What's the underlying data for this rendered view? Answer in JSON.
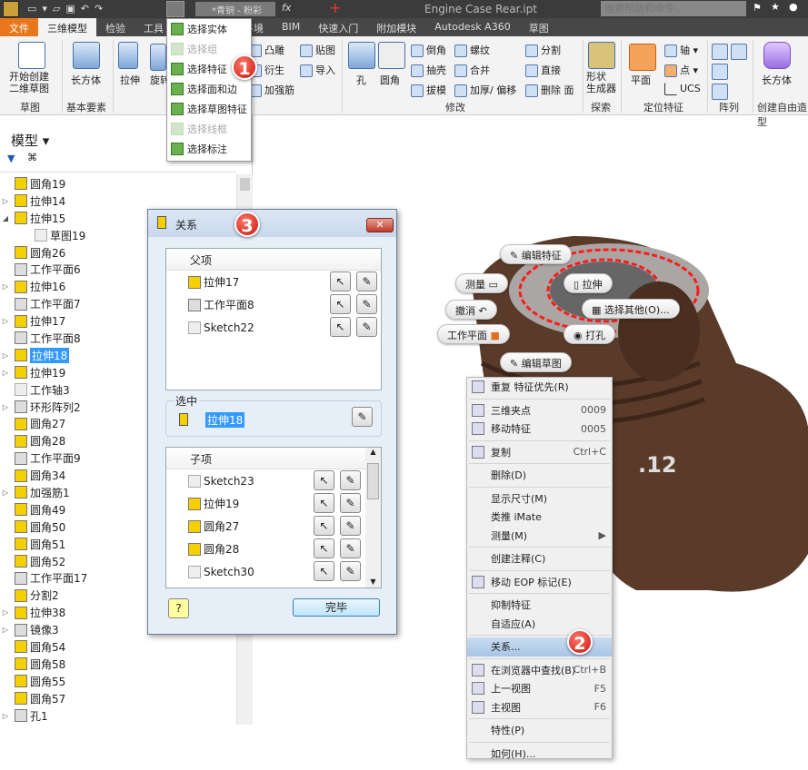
{
  "titlebar": {
    "title": "Engine Case Rear.ipt",
    "material": "*青铜 - 粉彩",
    "search_placeholder": "搜索帮助和命令..."
  },
  "tabs": [
    "文件",
    "三维模型",
    "检验",
    "工具",
    "环境",
    "BIM",
    "快速入门",
    "附加模块",
    "Autodesk A360",
    "草图"
  ],
  "ribbon": {
    "start_sketch": "开始创建\n二维草图",
    "box": "长方体",
    "extrude": "拉伸",
    "revolve": "旋转",
    "emboss": "凸雕",
    "derive": "衍生",
    "rib": "加强筋",
    "decal": "贴图",
    "import": "导入",
    "hole": "孔",
    "fillet": "圆角",
    "chamfer": "倒角",
    "thread": "螺纹",
    "split": "分割",
    "shell": "抽壳",
    "combine": "合并",
    "direct": "直接",
    "draft": "拔模",
    "thicken": "加厚/ 偏移",
    "delete_face": "删除 面",
    "shape_gen": "形状\n生成器",
    "plane": "平面",
    "axis": "轴",
    "point": "点",
    "ucs": "UCS",
    "freeform_box": "长方体",
    "groups": {
      "sketch": "草图",
      "primitives": "基本要素",
      "modify": "修改",
      "explore": "探索",
      "work_features": "定位特征",
      "pattern": "阵列",
      "freeform": "创建自由造型"
    }
  },
  "select_menu": [
    {
      "label": "选择实体",
      "enabled": true
    },
    {
      "label": "选择组",
      "enabled": false
    },
    {
      "label": "选择特征",
      "enabled": true
    },
    {
      "label": "选择面和边",
      "enabled": true
    },
    {
      "label": "选择草图特征",
      "enabled": true
    },
    {
      "label": "选择线框",
      "enabled": false
    },
    {
      "label": "选择标注",
      "enabled": true
    }
  ],
  "badges": [
    "1",
    "2",
    "3"
  ],
  "browser": {
    "title": "模型",
    "items": [
      {
        "label": "圆角19",
        "type": "fillet",
        "exp": ""
      },
      {
        "label": "拉伸14",
        "type": "extrude",
        "exp": "▷"
      },
      {
        "label": "拉伸15",
        "type": "extrude",
        "exp": "◢"
      },
      {
        "label": "草图19",
        "type": "sketch",
        "exp": "",
        "child": true
      },
      {
        "label": "圆角26",
        "type": "fillet",
        "exp": ""
      },
      {
        "label": "工作平面6",
        "type": "plane",
        "exp": ""
      },
      {
        "label": "拉伸16",
        "type": "extrude",
        "exp": "▷"
      },
      {
        "label": "工作平面7",
        "type": "plane",
        "exp": ""
      },
      {
        "label": "拉伸17",
        "type": "extrude",
        "exp": "▷"
      },
      {
        "label": "工作平面8",
        "type": "plane",
        "exp": ""
      },
      {
        "label": "拉伸18",
        "type": "extrude",
        "exp": "▷",
        "selected": true
      },
      {
        "label": "拉伸19",
        "type": "extrude",
        "exp": "▷"
      },
      {
        "label": "工作轴3",
        "type": "sketch",
        "exp": ""
      },
      {
        "label": "环形阵列2",
        "type": "plane",
        "exp": "▷"
      },
      {
        "label": "圆角27",
        "type": "fillet",
        "exp": ""
      },
      {
        "label": "圆角28",
        "type": "fillet",
        "exp": ""
      },
      {
        "label": "工作平面9",
        "type": "plane",
        "exp": ""
      },
      {
        "label": "圆角34",
        "type": "fillet",
        "exp": ""
      },
      {
        "label": "加强筋1",
        "type": "fillet",
        "exp": "▷"
      },
      {
        "label": "圆角49",
        "type": "fillet",
        "exp": ""
      },
      {
        "label": "圆角50",
        "type": "fillet",
        "exp": ""
      },
      {
        "label": "圆角51",
        "type": "fillet",
        "exp": ""
      },
      {
        "label": "圆角52",
        "type": "fillet",
        "exp": ""
      },
      {
        "label": "工作平面17",
        "type": "plane",
        "exp": ""
      },
      {
        "label": "分割2",
        "type": "fillet",
        "exp": ""
      },
      {
        "label": "拉伸38",
        "type": "extrude",
        "exp": "▷"
      },
      {
        "label": "镜像3",
        "type": "plane",
        "exp": "▷"
      },
      {
        "label": "圆角54",
        "type": "fillet",
        "exp": ""
      },
      {
        "label": "圆角58",
        "type": "fillet",
        "exp": ""
      },
      {
        "label": "圆角55",
        "type": "fillet",
        "exp": ""
      },
      {
        "label": "圆角57",
        "type": "fillet",
        "exp": ""
      },
      {
        "label": "孔1",
        "type": "plane",
        "exp": "▷"
      }
    ]
  },
  "dialog": {
    "title": "关系",
    "parents_header": "父项",
    "parents": [
      "拉伸17",
      "工作平面8",
      "Sketch22"
    ],
    "selected_label": "选中",
    "selected": "拉伸18",
    "children_header": "子项",
    "children": [
      "Sketch23",
      "拉伸19",
      "圆角27",
      "圆角28",
      "Sketch30"
    ],
    "help": "?",
    "done": "完毕"
  },
  "marking_menu": {
    "edit_feature": "编辑特征",
    "measure": "测量",
    "undo": "撤消",
    "work_plane": "工作平面",
    "extrude": "拉伸",
    "select_other": "选择其他(O)...",
    "hole": "打孔",
    "edit_sketch": "编辑草图"
  },
  "model_text": ".12",
  "context_menu": [
    {
      "label": "重复 特征优先(R)",
      "icon": true
    },
    {
      "sep": true
    },
    {
      "label": "三维夹点",
      "shortcut": "0009",
      "icon": true
    },
    {
      "label": "移动特征",
      "shortcut": "0005",
      "icon": true
    },
    {
      "sep": true
    },
    {
      "label": "复制",
      "shortcut": "Ctrl+C",
      "icon": true
    },
    {
      "sep": true
    },
    {
      "label": "删除(D)"
    },
    {
      "sep": true
    },
    {
      "label": "显示尺寸(M)"
    },
    {
      "label": "类推 iMate"
    },
    {
      "label": "测量(M)",
      "shortcut": "▶"
    },
    {
      "sep": true
    },
    {
      "label": "创建注释(C)"
    },
    {
      "sep": true
    },
    {
      "label": "移动 EOP 标记(E)",
      "icon": true
    },
    {
      "sep": true
    },
    {
      "label": "抑制特征"
    },
    {
      "label": "自适应(A)"
    },
    {
      "sep": true
    },
    {
      "label": "关系...",
      "highlight": true
    },
    {
      "sep": true
    },
    {
      "label": "在浏览器中查找(B)",
      "shortcut": "Ctrl+B",
      "icon": true
    },
    {
      "label": "上一视图",
      "shortcut": "F5",
      "icon": true
    },
    {
      "label": "主视图",
      "shortcut": "F6",
      "icon": true
    },
    {
      "sep": true
    },
    {
      "label": "特性(P)"
    },
    {
      "sep": true
    },
    {
      "label": "如何(H)..."
    }
  ],
  "colors": {
    "file_tab": "#e8771c",
    "selection": "#3399ff",
    "highlight_loop": "#ff1a1a",
    "model": "#5a3b2a",
    "badge": "#d4201a"
  }
}
